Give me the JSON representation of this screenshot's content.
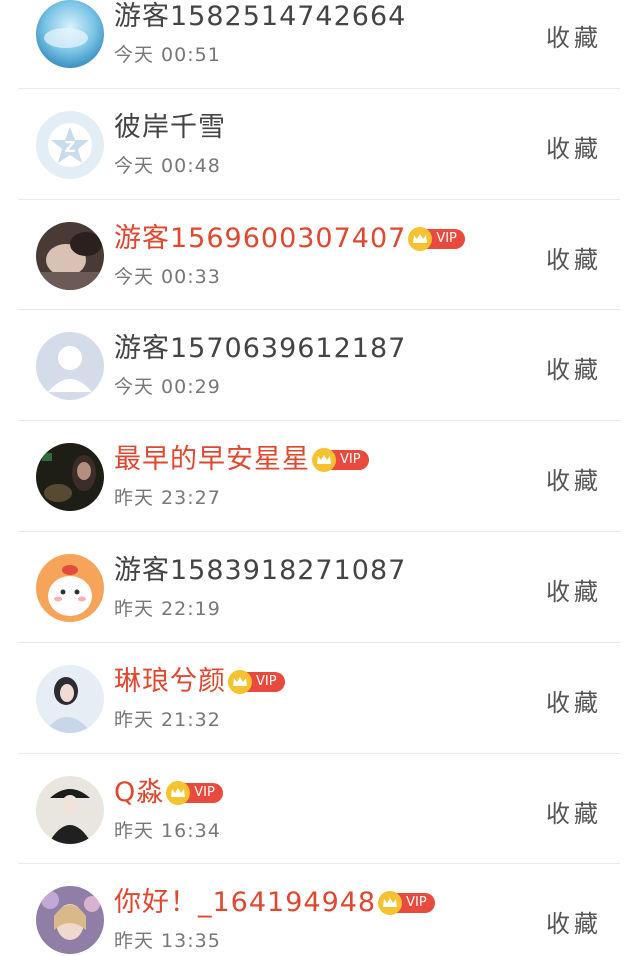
{
  "rows": [
    {
      "name": "游客1582514742664",
      "vip": false,
      "time": "今天 00:51",
      "action": "收藏",
      "avatar": "sky-blue-avatar"
    },
    {
      "name": "彼岸千雪",
      "vip": false,
      "time": "今天 00:48",
      "action": "收藏",
      "avatar": "default-star-avatar"
    },
    {
      "name": "游客1569600307407",
      "vip": true,
      "time": "今天 00:33",
      "action": "收藏",
      "avatar": "photo-avatar"
    },
    {
      "name": "游客1570639612187",
      "vip": false,
      "time": "今天 00:29",
      "action": "收藏",
      "avatar": "default-person-avatar"
    },
    {
      "name": "最早的早安星星",
      "vip": true,
      "time": "昨天 23:27",
      "action": "收藏",
      "avatar": "photo-avatar"
    },
    {
      "name": "游客1583918271087",
      "vip": false,
      "time": "昨天 22:19",
      "action": "收藏",
      "avatar": "cartoon-avatar"
    },
    {
      "name": "琳琅兮颜",
      "vip": true,
      "time": "昨天 21:32",
      "action": "收藏",
      "avatar": "photo-avatar"
    },
    {
      "name": "Q淼",
      "vip": true,
      "time": "昨天 16:34",
      "action": "收藏",
      "avatar": "photo-avatar"
    },
    {
      "name": "你好！_164194948",
      "vip": true,
      "time": "昨天 13:35",
      "action": "收藏",
      "avatar": "photo-avatar"
    }
  ],
  "vip_label": "VIP",
  "colors": {
    "vip_name": "#e1462e",
    "normal_name": "#444444",
    "vip_tag": "#e84a3e",
    "crown": "#f5c230"
  }
}
